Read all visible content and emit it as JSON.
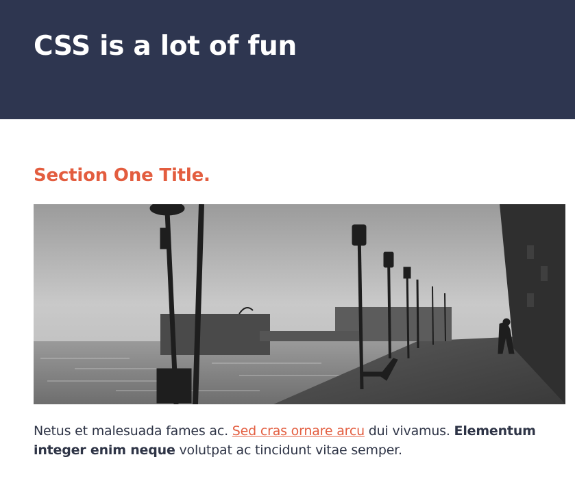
{
  "header": {
    "title": "CSS is a lot of fun"
  },
  "section": {
    "title": "Section One Title.",
    "paragraph": {
      "text_before_link": "Netus et malesuada fames ac. ",
      "link_text": "Sed cras ornare arcu",
      "text_after_link": " dui vivamus. ",
      "bold_text": "Elementum integer enim neque",
      "text_end": " volutpat ac tincidunt vitae semper."
    }
  },
  "colors": {
    "header_bg": "#2e3650",
    "accent": "#e35d3f",
    "body_text": "#2e3446"
  }
}
